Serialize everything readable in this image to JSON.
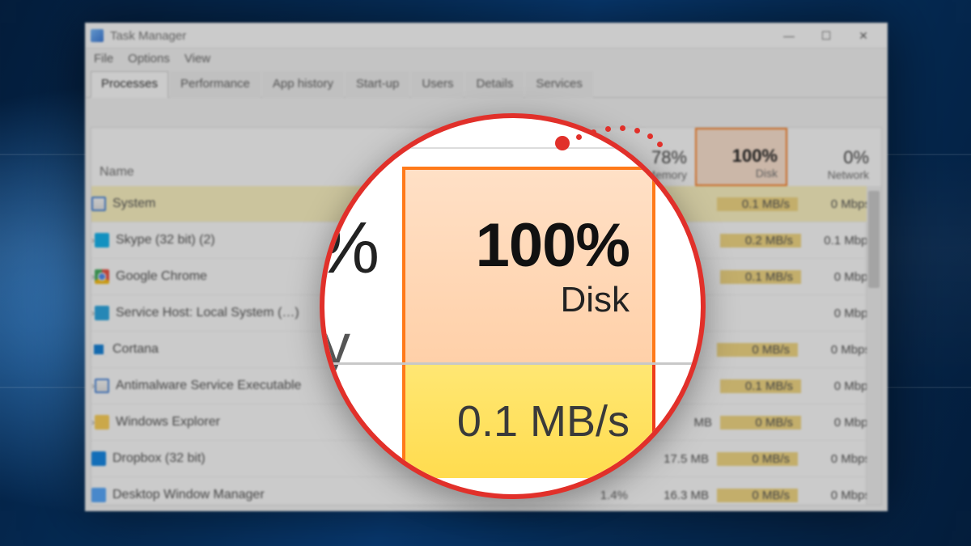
{
  "window": {
    "title": "Task Manager",
    "menu": {
      "file": "File",
      "options": "Options",
      "view": "View"
    },
    "controls": {
      "min": "—",
      "max": "☐",
      "close": "✕"
    }
  },
  "tabs": {
    "processes": "Processes",
    "performance": "Performance",
    "apphistory": "App history",
    "startup": "Start-up",
    "users": "Users",
    "details": "Details",
    "services": "Services"
  },
  "columns": {
    "name": "Name",
    "memory": {
      "pct": "78%",
      "label": "Memory"
    },
    "disk": {
      "pct": "100%",
      "label": "Disk"
    },
    "network": {
      "pct": "0%",
      "label": "Network"
    }
  },
  "processes": [
    {
      "expand": "",
      "icon": "i-sys",
      "name": "System",
      "cpu": "",
      "mem": "",
      "disk": "0.1 MB/s",
      "net": "0 Mbps"
    },
    {
      "expand": "›",
      "icon": "i-skype",
      "name": "Skype (32 bit) (2)",
      "cpu": "",
      "mem": "",
      "disk": "0.2 MB/s",
      "net": "0.1 Mbps"
    },
    {
      "expand": "›",
      "icon": "i-chrome",
      "name": "Google Chrome",
      "cpu": "",
      "mem": "",
      "disk": "0.1 MB/s",
      "net": "0 Mbps"
    },
    {
      "expand": "›",
      "icon": "i-svc",
      "name": "Service Host: Local System (…)",
      "cpu": "",
      "mem": "",
      "disk": "",
      "net": "0 Mbps"
    },
    {
      "expand": "",
      "icon": "i-cortana",
      "name": "Cortana",
      "cpu": "",
      "mem": "",
      "disk": "0 MB/s",
      "net": "0 Mbps"
    },
    {
      "expand": "›",
      "icon": "i-amw",
      "name": "Antimalware Service Executable",
      "cpu": "",
      "mem": "",
      "disk": "0.1 MB/s",
      "net": "0 Mbps"
    },
    {
      "expand": "›",
      "icon": "i-exp",
      "name": "Windows Explorer",
      "cpu": "",
      "mem": "MB",
      "disk": "0 MB/s",
      "net": "0 Mbps"
    },
    {
      "expand": "",
      "icon": "i-dbx",
      "name": "Dropbox (32 bit)",
      "cpu": "",
      "mem": "17.5 MB",
      "disk": "0 MB/s",
      "net": "0 Mbps"
    },
    {
      "expand": "",
      "icon": "i-dwm",
      "name": "Desktop Window Manager",
      "cpu": "1.4%",
      "mem": "16.3 MB",
      "disk": "0 MB/s",
      "net": "0 Mbps"
    }
  ],
  "magnifier": {
    "pct_fragment": "%",
    "y_fragment": "y",
    "disk_pct": "100%",
    "disk_label": "Disk",
    "disk_value": "0.1 MB/s"
  }
}
